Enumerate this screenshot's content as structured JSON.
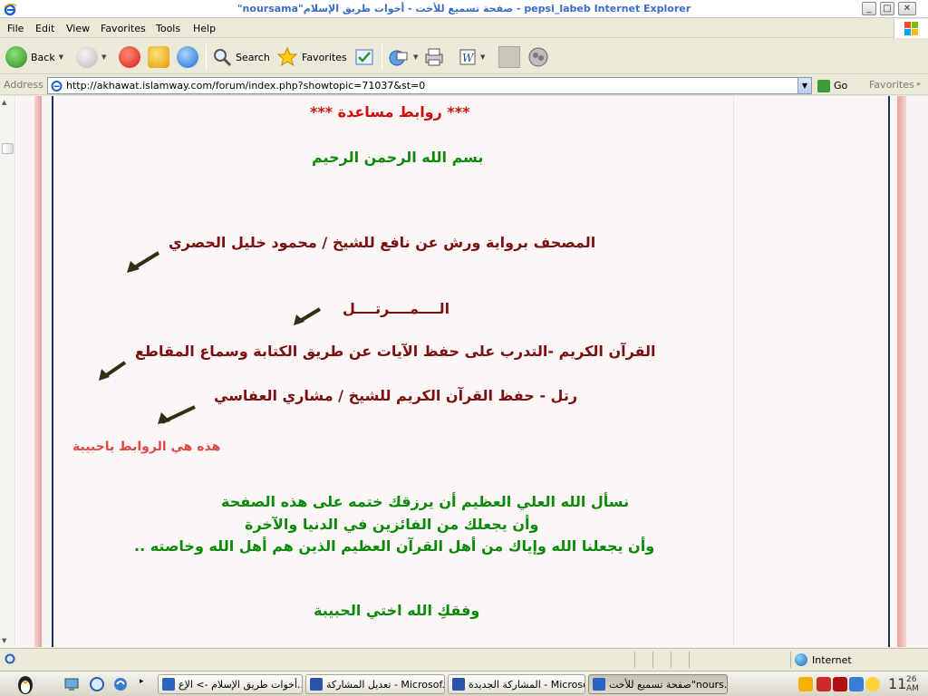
{
  "window": {
    "title": "\"noursama\"صفحة تسميع للأخت - أخوات طريق الإسلام - pepsi_labeb Internet Explorer"
  },
  "menu": [
    "File",
    "Edit",
    "View",
    "Favorites",
    "Tools",
    "Help"
  ],
  "toolbar": {
    "back_label": "Back",
    "search_label": "Search",
    "favorites_label": "Favorites"
  },
  "address": {
    "label": "Address",
    "url": "http://akhawat.islamway.com/forum/index.php?showtopic=71037&st=0",
    "go_label": "Go",
    "favorites_label": "Favorites"
  },
  "post": {
    "header": "*** روابط مساعدة ***",
    "basmala": "بسم الله الرحمن الرحيم",
    "link1": "المصحف برواية ورش عن نافع للشيخ / محمود خليل الحصري",
    "link2": "الــــمــــرتــــل",
    "link3": "القرآن الكريم -التدرب على حفظ الآيات عن طريق الكتابة وسماع المقاطع",
    "link4": "رتل - حفظ القرآن الكريم للشيخ / مشاري العفاسي",
    "note": "هذه هي الروابط ياحبيبة",
    "prayer1": "نسأل الله العلي العظيم أن يرزقك ختمه على هذه الصفحة",
    "prayer2": "وأن يجعلك من الفائزين في الدنيا والآخرة",
    "prayer3": "وأن يجعلنا الله وإياك من أهل القرآن العظيم الذين هم أهل الله وخاصته ..",
    "closing": "وفقكِ الله اختي الحبيبة"
  },
  "status": {
    "zone": "Internet"
  },
  "taskbar": {
    "tasks": [
      "أخوات طريق الإسلام -> الإع...",
      "تعديل المشاركة - Microsof...",
      "المشاركة الجديدة - Microso...",
      "صفحة تسميع للأخت\"nours..."
    ],
    "clock_time": "11",
    "clock_min": "26",
    "clock_ampm": "AM"
  },
  "colors": {
    "header_red": "#d01010",
    "green": "#0a8a0a",
    "maroon": "#7a1010",
    "pink": "#e04848",
    "frame_navy": "#1a2f6b"
  }
}
